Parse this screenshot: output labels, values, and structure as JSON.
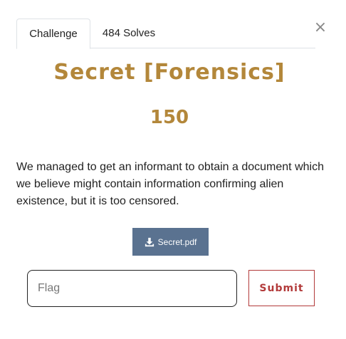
{
  "tabs": [
    {
      "label": "Challenge",
      "active": true
    },
    {
      "label": "484 Solves",
      "active": false
    }
  ],
  "close": {
    "glyph": "×"
  },
  "challenge": {
    "title": "Secret [Forensics]",
    "points": "150",
    "description": "We managed to get an informant to obtain a document which we believe might contain information confirming alien existence, but it is too censored."
  },
  "file": {
    "label": "Secret.pdf",
    "icon": "download-icon"
  },
  "flag": {
    "placeholder": "Flag",
    "value": ""
  },
  "submit": {
    "label": "Submit"
  },
  "colors": {
    "accent": "#b3873a",
    "file_button": "#5a7290",
    "submit": "#b23a3a"
  }
}
